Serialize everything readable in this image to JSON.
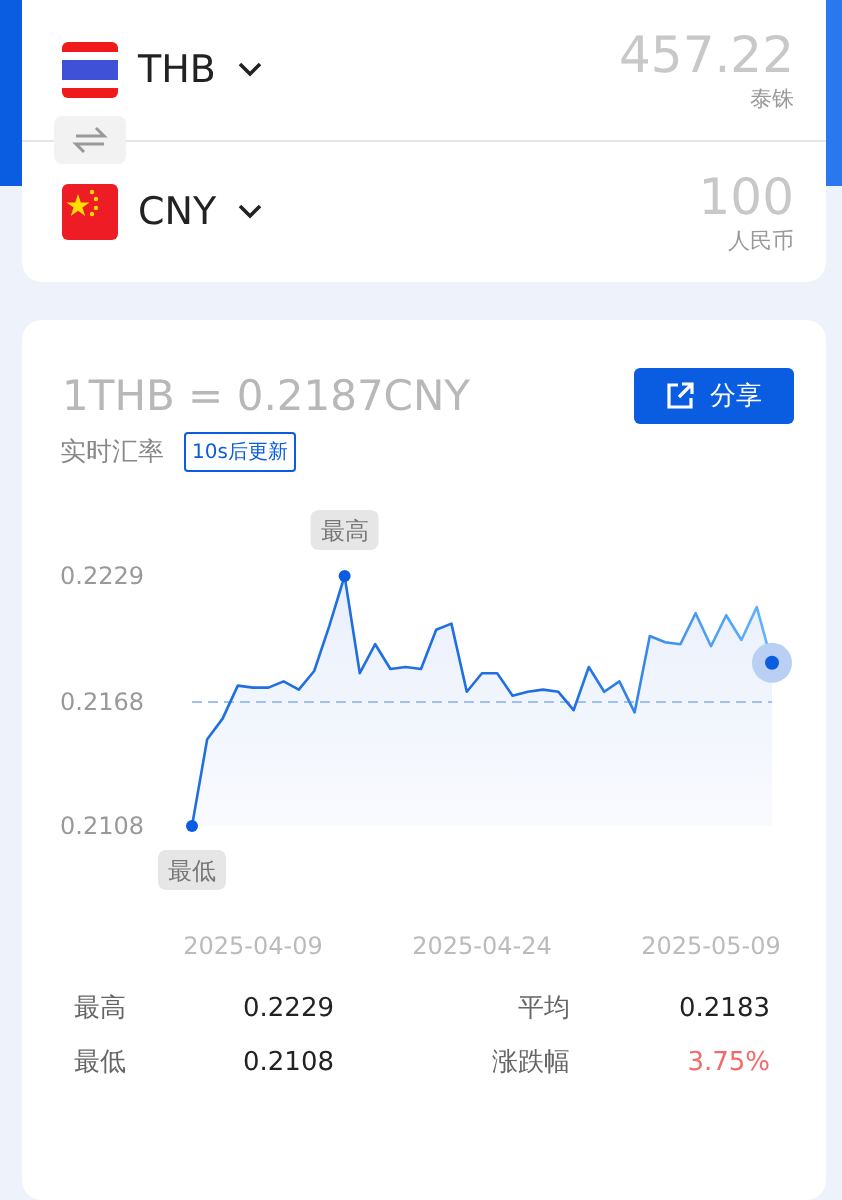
{
  "converter": {
    "currencies": [
      {
        "code": "THB",
        "amount": "457.22",
        "name": "泰铢"
      },
      {
        "code": "CNY",
        "amount": "100",
        "name": "人民币"
      }
    ]
  },
  "rate_panel": {
    "rate": "1THB = 0.2187CNY",
    "share_button": "分享",
    "rate_label": "实时汇率",
    "refresh_badge": "10s后更新",
    "chart_data": {
      "type": "area",
      "categories": [
        null,
        null,
        null,
        null,
        "2025-04-09",
        null,
        null,
        null,
        null,
        null,
        null,
        null,
        null,
        null,
        null,
        null,
        null,
        null,
        null,
        "2025-04-24",
        null,
        null,
        null,
        null,
        null,
        null,
        null,
        null,
        null,
        null,
        null,
        null,
        null,
        null,
        "2025-05-09",
        null,
        null,
        null,
        null
      ],
      "series": [
        {
          "color": "#1f6fe0",
          "values": [
            0.2108,
            0.215,
            0.216,
            0.2176,
            0.2175,
            0.2175,
            0.2178,
            0.2174,
            0.2183,
            0.2205,
            0.2229,
            0.2182,
            0.2196,
            0.2184,
            0.2185,
            0.2184,
            0.2203,
            0.2206,
            0.2173,
            0.2182,
            0.2182,
            0.2171,
            0.2173,
            0.2174,
            0.2173,
            0.2164,
            0.2185,
            0.2173,
            0.2178,
            0.2163,
            0.22,
            0.2197,
            0.2196,
            0.2211,
            0.2195,
            0.221,
            0.2198,
            0.2214,
            0.2187
          ]
        }
      ],
      "ylim": [
        0.2108,
        0.2229
      ],
      "yticks": [
        {
          "value": 0.2229,
          "label": "0.2229"
        },
        {
          "value": 0.2168,
          "label": "0.2168"
        },
        {
          "value": 0.2108,
          "label": "0.2108"
        }
      ],
      "annotations": [
        {
          "text": "最高",
          "y": 0.2229
        },
        {
          "text": "最低",
          "y": 0.2108
        }
      ],
      "ref_lines": [
        {
          "axis": "y",
          "value": 0.2168
        }
      ]
    },
    "stats": [
      {
        "label": "最高",
        "value": "0.2229",
        "color": "#222222"
      },
      {
        "label": "平均",
        "value": "0.2183",
        "color": "#222222"
      },
      {
        "label": "最低",
        "value": "0.2108",
        "color": "#222222"
      },
      {
        "label": "涨跌幅",
        "value": "3.75%",
        "color": "#f26b6b"
      }
    ]
  }
}
